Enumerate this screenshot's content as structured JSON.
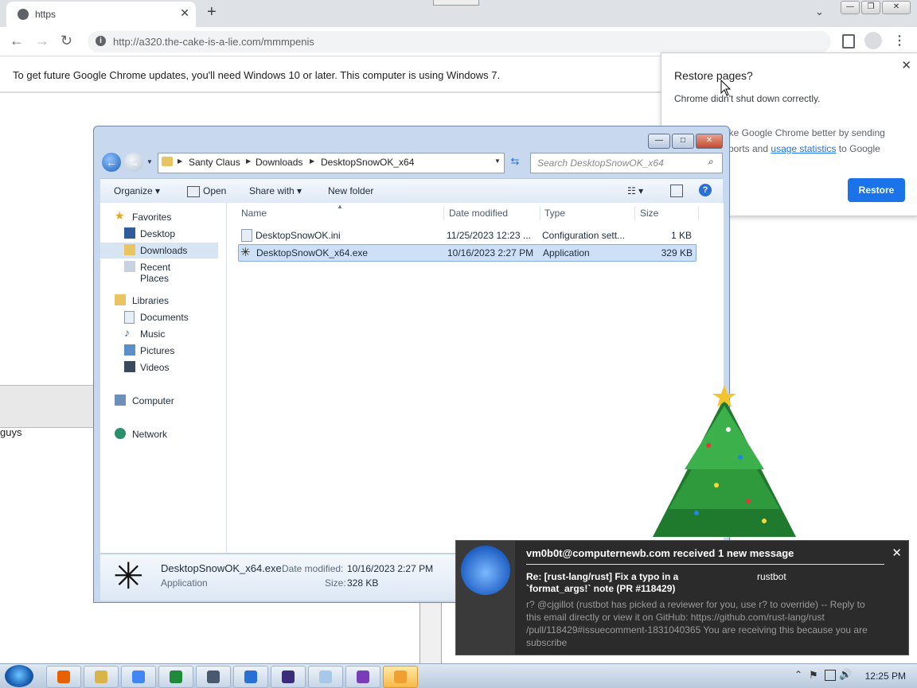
{
  "chrome": {
    "tab_title": "https",
    "url": "http://a320.the-cake-is-a-lie.com/mmmpenis",
    "update_message": "To get future Google Chrome updates, you'll need Windows 10 or later. This computer is using Windows 7."
  },
  "restore_popup": {
    "title": "Restore pages?",
    "message": "Chrome didn't shut down correctly.",
    "help_text_1": "ake Google Chrome better by sending",
    "help_text_2": "ports and",
    "link": "usage statistics",
    "help_text_3": "to Google",
    "button": "Restore"
  },
  "background_page": {
    "text": "guys"
  },
  "explorer": {
    "breadcrumb": [
      "Santy Claus",
      "Downloads",
      "DesktopSnowOK_x64"
    ],
    "search_placeholder": "Search DesktopSnowOK_x64",
    "commands": {
      "organize": "Organize",
      "open": "Open",
      "share_with": "Share with",
      "new_folder": "New folder"
    },
    "nav": {
      "favorites": "Favorites",
      "desktop": "Desktop",
      "downloads": "Downloads",
      "recent": "Recent Places",
      "libraries": "Libraries",
      "documents": "Documents",
      "music": "Music",
      "pictures": "Pictures",
      "videos": "Videos",
      "computer": "Computer",
      "network": "Network"
    },
    "columns": {
      "name": "Name",
      "date": "Date modified",
      "type": "Type",
      "size": "Size"
    },
    "files": [
      {
        "name": "DesktopSnowOK.ini",
        "date": "11/25/2023 12:23 ...",
        "type": "Configuration sett...",
        "size": "1 KB"
      },
      {
        "name": "DesktopSnowOK_x64.exe",
        "date": "10/16/2023 2:27 PM",
        "type": "Application",
        "size": "329 KB"
      }
    ],
    "details": {
      "name": "DesktopSnowOK_x64.exe",
      "type": "Application",
      "date_label": "Date modified:",
      "date_value": "10/16/2023 2:27 PM",
      "size_label": "Size:",
      "size_value": "328 KB"
    }
  },
  "notification": {
    "header": "vm0b0t@computernewb.com received 1 new message",
    "subject": "Re: [rust-lang/rust] Fix a typo in a `format_args!` note (PR #118429)",
    "sender": "rustbot",
    "body": "r? @cjgillot (rustbot has picked a reviewer for you, use r? to override) -- Reply to this email directly or view it on GitHub: https://github.com/rust-lang/rust /pull/118429#issuecomment-1831040365 You are receiving this because you are subscribe"
  },
  "taskbar": {
    "apps": [
      "firefox-icon",
      "explorer-icon",
      "chrome-icon",
      "tree-icon",
      "monitor-icon",
      "thunderbird-icon",
      "usb-icon",
      "notepad-icon",
      "media-icon",
      "snowok-icon"
    ],
    "app_colors": [
      "#e66000",
      "#d9b44a",
      "#4285f4",
      "#1f8a3a",
      "#4a5a6e",
      "#2a6fd6",
      "#3a2c7a",
      "#a8c8e8",
      "#7a3db8",
      "#f0a030"
    ],
    "clock": "12:25 PM"
  }
}
